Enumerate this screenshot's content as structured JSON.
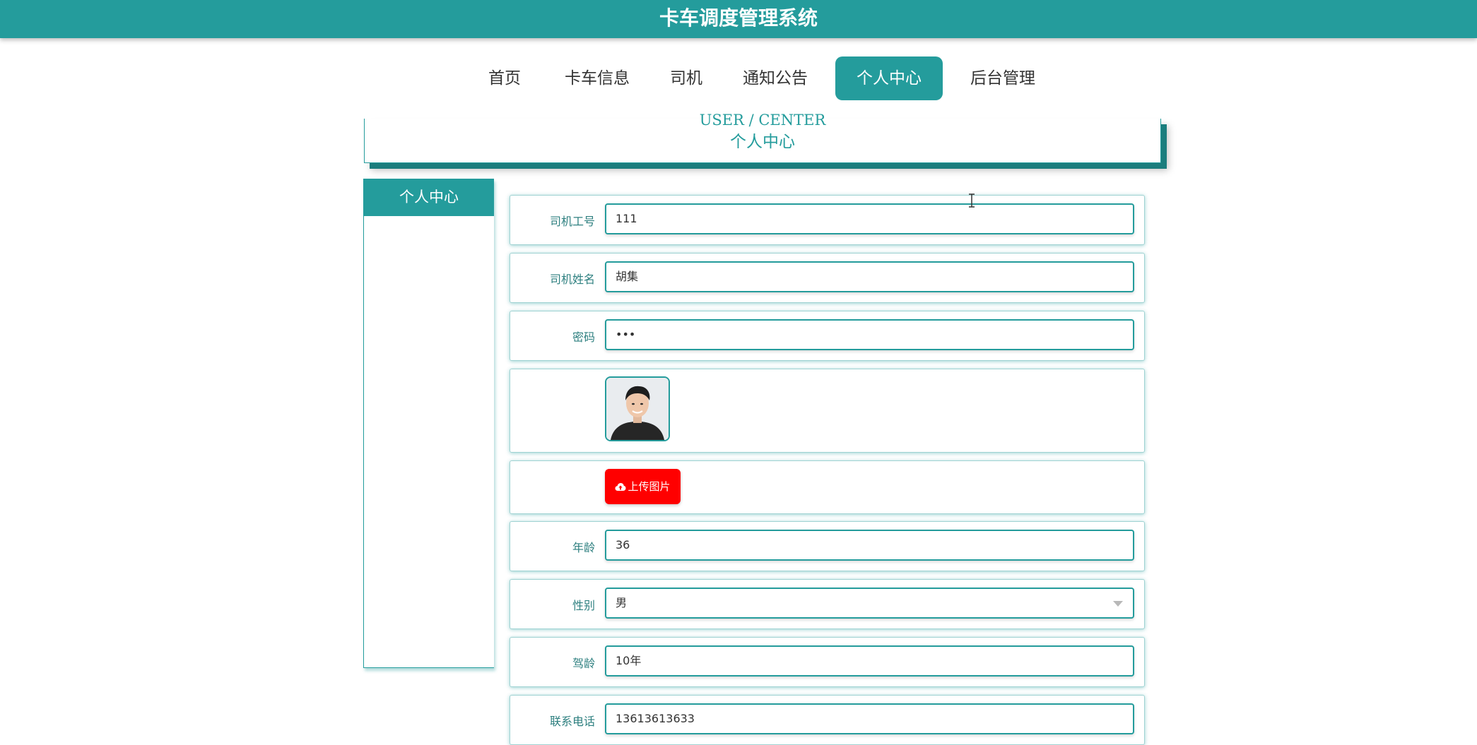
{
  "header": {
    "title": "卡车调度管理系统"
  },
  "nav": {
    "items": [
      {
        "label": "首页"
      },
      {
        "label": "卡车信息"
      },
      {
        "label": "司机"
      },
      {
        "label": "通知公告"
      },
      {
        "label": "个人中心",
        "active": true
      },
      {
        "label": "后台管理"
      }
    ]
  },
  "banner": {
    "subtitle_en": "USER / CENTER",
    "title": "个人中心"
  },
  "sidebar": {
    "title": "个人中心"
  },
  "form": {
    "driver_id": {
      "label": "司机工号",
      "value": "111"
    },
    "driver_name": {
      "label": "司机姓名",
      "value": "胡集"
    },
    "password": {
      "label": "密码",
      "value": "•••"
    },
    "photo": {
      "label": ""
    },
    "upload": {
      "label": "上传图片"
    },
    "age": {
      "label": "年龄",
      "value": "36"
    },
    "gender": {
      "label": "性别",
      "value": "男"
    },
    "driving_years": {
      "label": "驾龄",
      "value": "10年"
    },
    "phone": {
      "label": "联系电话",
      "value": "13613613633"
    }
  },
  "colors": {
    "primary": "#249c9c",
    "upload_button": "#ff0000"
  },
  "icons": {
    "upload": "cloud-upload-icon",
    "dropdown": "chevron-down-icon"
  }
}
